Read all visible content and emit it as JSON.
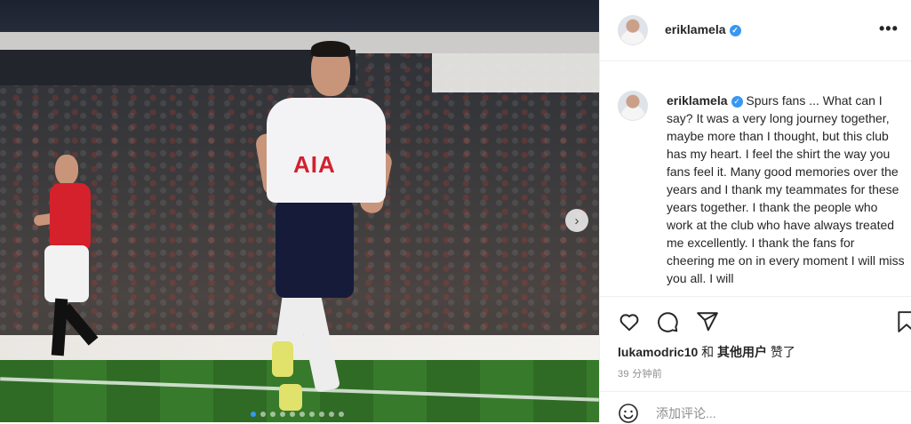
{
  "post": {
    "author": "eriklamela",
    "more_label": "•••",
    "caption_user": "eriklamela",
    "caption_text": "Spurs fans ... What can I say? It was a very long journey together, maybe more than I thought, but this club has my heart. I feel the shirt the way you fans feel it. Many good memories over the years and I thank my teammates for these years together. I thank the people who work at the club who have always treated me excellently. I thank the fans for cheering me on in every moment I will miss you all. I will",
    "shirt_sponsor": "AIA",
    "next_label": "›",
    "carousel_active": 0,
    "carousel_count": 10
  },
  "engagement": {
    "liked_by": "lukamodric10",
    "and": " 和 ",
    "others": "其他用户",
    "liked_suffix": " 赞了",
    "time": "39 分钟前"
  },
  "actions": {
    "icons": [
      "heart-icon",
      "comment-icon",
      "share-icon",
      "bookmark-icon"
    ]
  },
  "comment": {
    "placeholder": "添加评论..."
  },
  "colors": {
    "verified": "#3897f0",
    "text": "#262626",
    "muted": "#8e8e8e",
    "border": "#efefef"
  }
}
